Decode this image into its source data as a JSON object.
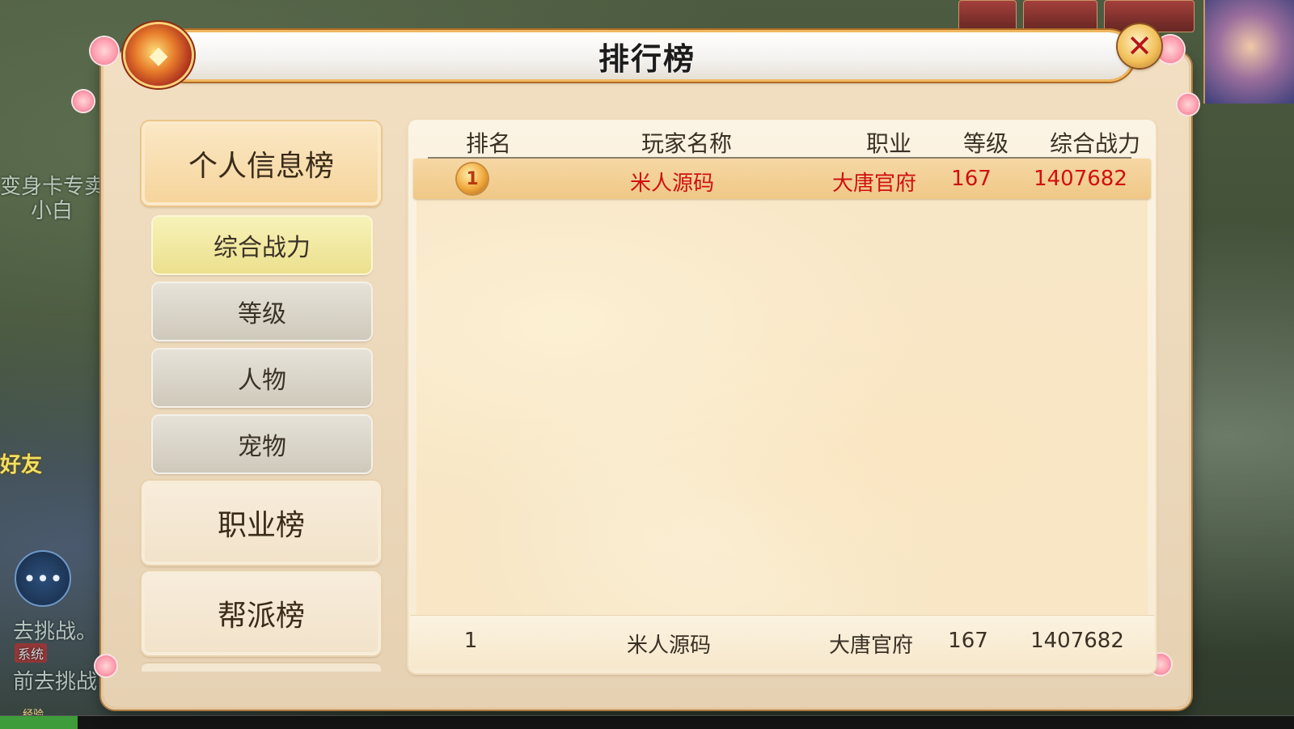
{
  "background": {
    "left_texts": [
      "变身卡专卖",
      "小白",
      "去挑战。",
      "前去挑战"
    ],
    "chat_icon": "chat-bubble-icon",
    "friend_label": "好友",
    "system_tag": "系统",
    "exp_label": "经验",
    "exp_progress": 0.06
  },
  "window": {
    "title": "排行榜",
    "close_icon": "close-x-icon",
    "ornament_icon": "treasure-bag-icon"
  },
  "menu": {
    "categories": [
      {
        "label": "个人信息榜",
        "active": true
      },
      {
        "label": "职业榜",
        "active": false
      },
      {
        "label": "帮派榜",
        "active": false
      }
    ],
    "sub_items": [
      {
        "label": "综合战力",
        "active": true
      },
      {
        "label": "等级",
        "active": false
      },
      {
        "label": "人物",
        "active": false
      },
      {
        "label": "宠物",
        "active": false
      }
    ]
  },
  "table": {
    "headers": {
      "rank": "排名",
      "name": "玩家名称",
      "job": "职业",
      "level": "等级",
      "power": "综合战力"
    },
    "rows": [
      {
        "rank": "1",
        "rank_icon": "gold-medal-icon",
        "name": "米人源码",
        "job": "大唐官府",
        "level": "167",
        "power": "1407682"
      }
    ],
    "self_row": {
      "rank": "1",
      "name": "米人源码",
      "job": "大唐官府",
      "level": "167",
      "power": "1407682"
    }
  },
  "colors": {
    "highlight_text": "#d01010",
    "title_border": "#f0b860",
    "active_sub": "#ece08e"
  }
}
